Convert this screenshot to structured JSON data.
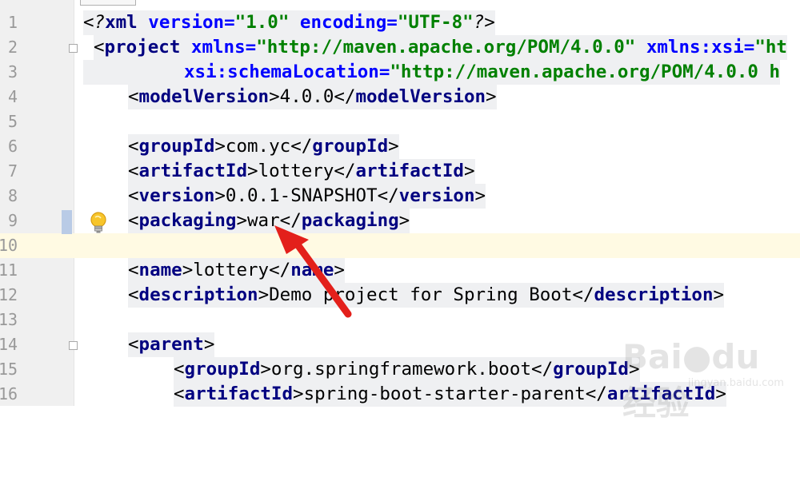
{
  "editor": {
    "lines": [
      {
        "n": "1"
      },
      {
        "n": "2"
      },
      {
        "n": "3"
      },
      {
        "n": "4"
      },
      {
        "n": "5"
      },
      {
        "n": "6"
      },
      {
        "n": "7"
      },
      {
        "n": "8"
      },
      {
        "n": "9"
      },
      {
        "n": "10"
      },
      {
        "n": "11"
      },
      {
        "n": "12"
      },
      {
        "n": "13"
      },
      {
        "n": "14"
      },
      {
        "n": "15"
      },
      {
        "n": "16"
      }
    ],
    "l1": {
      "open": "<?",
      "tag": "xml",
      "a1": " version=",
      "v1": "\"1.0\"",
      "a2": " encoding=",
      "v2": "\"UTF-8\"",
      "close": "?>"
    },
    "l2": {
      "open": "<",
      "tag": "project",
      "a1": " xmlns=",
      "v1": "\"http://maven.apache.org/POM/4.0.0\"",
      "a2": " xmlns:xsi=",
      "v2": "\"ht"
    },
    "l3": {
      "a1": "xsi:schemaLocation=",
      "v1": "\"http://maven.apache.org/POM/4.0.0 h"
    },
    "l4": {
      "tag": "modelVersion",
      "value": "4.0.0"
    },
    "l6": {
      "tag": "groupId",
      "value": "com.yc"
    },
    "l7": {
      "tag": "artifactId",
      "value": "lottery"
    },
    "l8": {
      "tag": "version",
      "value": "0.0.1-SNAPSHOT"
    },
    "l9": {
      "tag": "packaging",
      "value": "war"
    },
    "l11": {
      "tag": "name",
      "value": "lottery"
    },
    "l12": {
      "tag": "description",
      "value": "Demo project for Spring Boot"
    },
    "l14": {
      "tag": "parent"
    },
    "l15": {
      "tag": "groupId",
      "value": "org.springframework.boot"
    },
    "l16": {
      "tag": "artifactId",
      "value": "spring-boot-starter-parent"
    }
  },
  "watermark": {
    "brand": "Bai●du 经验",
    "site": "jingyan.baidu.com"
  },
  "colors": {
    "tag": "#000080",
    "attr": "#0000ff",
    "value": "#008000",
    "current_line": "#fffae3",
    "arrow": "#e3201b"
  }
}
